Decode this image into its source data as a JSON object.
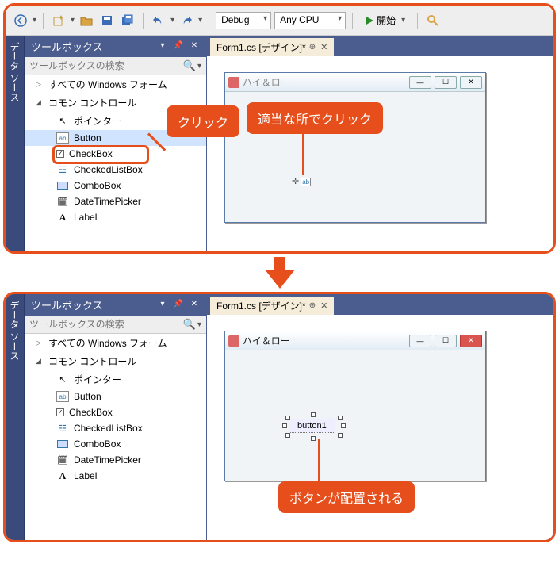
{
  "toolbar": {
    "config": "Debug",
    "platform": "Any CPU",
    "start_label": "開始"
  },
  "side_tab": "データ ソース",
  "toolbox": {
    "title": "ツールボックス",
    "search_placeholder": "ツールボックスの検索",
    "group_all": "すべての Windows フォーム",
    "group_common": "コモン コントロール",
    "items": [
      {
        "label": "ポインター"
      },
      {
        "label": "Button"
      },
      {
        "label": "CheckBox"
      },
      {
        "label": "CheckedListBox"
      },
      {
        "label": "ComboBox"
      },
      {
        "label": "DateTimePicker"
      },
      {
        "label": "Label"
      }
    ]
  },
  "file_tab": "Form1.cs [デザイン]*",
  "form_title": "ハイ＆ロー",
  "placed_button_text": "button1",
  "callouts": {
    "click": "クリック",
    "click_anywhere": "適当な所でクリック",
    "button_placed": "ボタンが配置される"
  }
}
